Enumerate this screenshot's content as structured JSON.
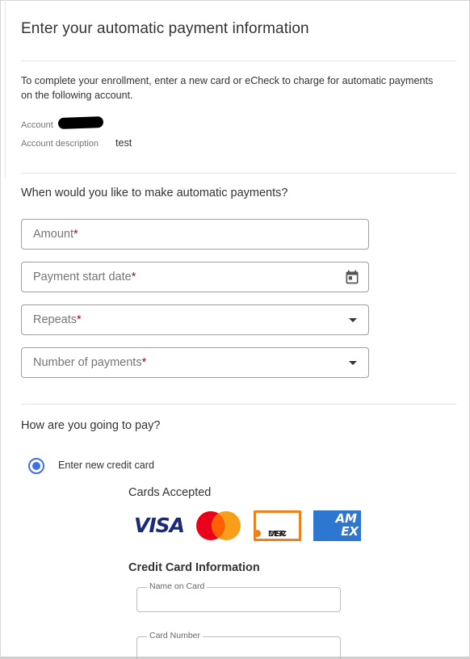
{
  "page": {
    "title": "Enter your automatic payment information",
    "intro": "To complete your enrollment, enter a new card or eCheck to charge for automatic payments on the following account.",
    "account_label": "Account",
    "account_description_label": "Account description",
    "account_description_value": "test"
  },
  "schedule": {
    "heading": "When would you like to make automatic payments?",
    "amount_placeholder": "Amount",
    "start_date_placeholder": "Payment start date",
    "repeats_placeholder": "Repeats",
    "num_payments_placeholder": "Number of payments",
    "required_mark": "*"
  },
  "payment": {
    "heading": "How are you going to pay?",
    "option_new_card": "Enter new credit card",
    "cards_accepted": "Cards Accepted",
    "logos": {
      "visa": "VISA",
      "discover": "DISC",
      "discover_tail": "VER",
      "amex_top": "AM",
      "amex_bottom": "EX"
    },
    "cc_info_title": "Credit Card Information",
    "name_on_card_label": "Name on Card",
    "card_number_label": "Card Number"
  },
  "colors": {
    "accent": "#3f6fe5",
    "required": "#b0003a"
  }
}
